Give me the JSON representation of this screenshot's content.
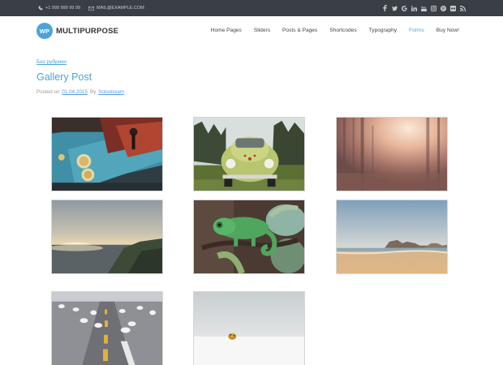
{
  "topbar": {
    "phone": "+1 999 999 99 99",
    "email": "MAIL@EXAMPLE.COM",
    "social_icons": [
      "facebook-icon",
      "twitter-icon",
      "google-plus-icon",
      "linkedin-icon",
      "youtube-icon",
      "instagram-icon",
      "pinterest-icon",
      "flickr-icon",
      "rss-icon"
    ]
  },
  "header": {
    "logo_badge": "WP",
    "logo_text": "MULTIPURPOSE",
    "nav": [
      {
        "label": "Home Pages"
      },
      {
        "label": "Sliders"
      },
      {
        "label": "Posts & Pages"
      },
      {
        "label": "Shortcodes"
      },
      {
        "label": "Typography"
      },
      {
        "label": "Forms"
      },
      {
        "label": "Buy Now!"
      }
    ],
    "active_nav": "Forms"
  },
  "post": {
    "category": "Без рубрики",
    "title": "Gallery Post",
    "posted_on_label": "Posted on",
    "date": "01.04.2015",
    "by_label": "By",
    "author": "Solostream"
  },
  "gallery": {
    "images": [
      {
        "subject": "arcade-joystick"
      },
      {
        "subject": "vintage-beetle-car"
      },
      {
        "subject": "sunlit-forest"
      },
      {
        "subject": "coastal-sunset"
      },
      {
        "subject": "green-chameleon"
      },
      {
        "subject": "sandy-beach-rocks"
      },
      {
        "subject": "seagulls-on-road"
      },
      {
        "subject": "ladybug-in-snow"
      }
    ]
  },
  "colors": {
    "accent": "#4ba3d9",
    "topbar_bg": "#3a3f46",
    "text": "#444444",
    "meta": "#999999"
  }
}
